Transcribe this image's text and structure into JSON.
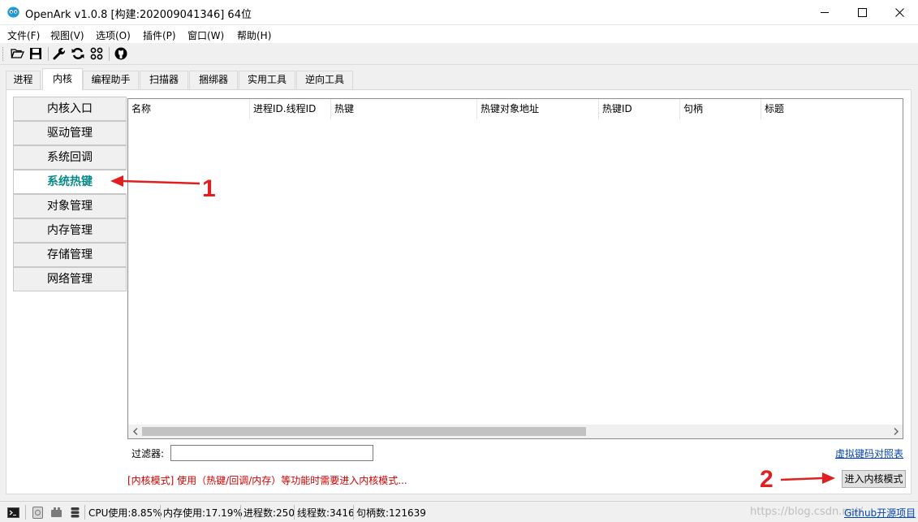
{
  "window": {
    "title": "OpenArk v1.0.8  [构建:202009041346]  64位"
  },
  "menu": [
    {
      "label": "文件(F)"
    },
    {
      "label": "视图(V)"
    },
    {
      "label": "选项(O)"
    },
    {
      "label": "插件(P)"
    },
    {
      "label": "窗口(W)"
    },
    {
      "label": "帮助(H)"
    }
  ],
  "toolbar": {
    "icons": [
      "open-folder-icon",
      "save-icon",
      "wrench-icon",
      "refresh-icon",
      "grid-icon",
      "github-icon"
    ]
  },
  "tabs": [
    {
      "label": "进程"
    },
    {
      "label": "内核",
      "active": true
    },
    {
      "label": "编程助手"
    },
    {
      "label": "扫描器"
    },
    {
      "label": "捆绑器"
    },
    {
      "label": "实用工具"
    },
    {
      "label": "逆向工具"
    }
  ],
  "sidebar": {
    "items": [
      {
        "label": "内核入口"
      },
      {
        "label": "驱动管理"
      },
      {
        "label": "系统回调"
      },
      {
        "label": "系统热键",
        "active": true
      },
      {
        "label": "对象管理"
      },
      {
        "label": "内存管理"
      },
      {
        "label": "存储管理"
      },
      {
        "label": "网络管理"
      }
    ]
  },
  "table": {
    "columns": [
      "名称",
      "进程ID.线程ID",
      "热键",
      "热键对象地址",
      "热键ID",
      "句柄",
      "标题"
    ],
    "rows": []
  },
  "filter": {
    "label": "过滤器:",
    "value": "",
    "vk_link": "虚拟键码对照表"
  },
  "notice": "[内核模式] 使用（热键/回调/内存）等功能时需要进入内核模式...",
  "kernel_button": "进入内核模式",
  "status": {
    "cpu": "CPU使用:8.85%",
    "memory": "内存使用:17.19%",
    "processes": "进程数:250",
    "threads": "线程数:3416",
    "handles": "句柄数:121639",
    "github_link": "Github开源项目",
    "watermark": "https://blog.csdn.net/"
  },
  "annotations": [
    {
      "number": "1",
      "target": "系统热键"
    },
    {
      "number": "2",
      "target": "进入内核模式"
    }
  ],
  "colors": {
    "active_sidebar_text": "#088a88",
    "notice_text": "#cc0000",
    "annotation": "#e02020",
    "link": "#0645ad"
  }
}
